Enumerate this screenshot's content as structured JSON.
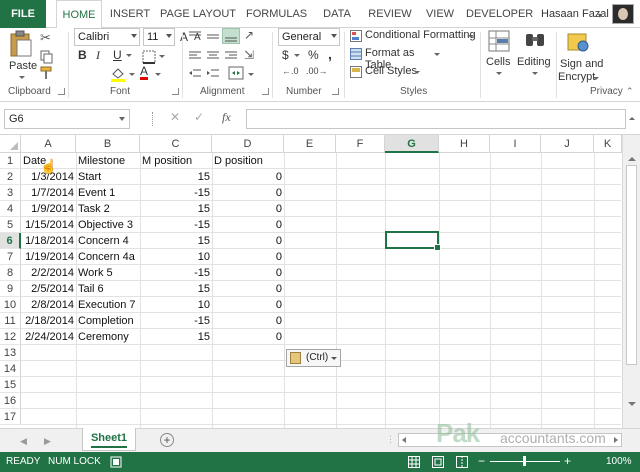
{
  "tabs": {
    "file": "FILE",
    "home": "HOME",
    "insert": "INSERT",
    "page_layout": "PAGE LAYOUT",
    "formulas": "FORMULAS",
    "data": "DATA",
    "review": "REVIEW",
    "view": "VIEW",
    "developer": "DEVELOPER",
    "user": "Hasaan Fazal"
  },
  "ribbon": {
    "clipboard": {
      "label": "Clipboard",
      "paste": "Paste"
    },
    "font": {
      "label": "Font",
      "name": "Calibri",
      "size": "11",
      "bold": "B",
      "italic": "I",
      "underline": "U",
      "grow": "A",
      "shrink": "A",
      "font_color_letter": "A"
    },
    "alignment": {
      "label": "Alignment"
    },
    "number": {
      "label": "Number",
      "format": "General",
      "currency": "$",
      "percent": "%",
      "comma": ","
    },
    "styles": {
      "label": "Styles",
      "conditional": "Conditional Formatting",
      "format_table": "Format as Table",
      "cell_styles": "Cell Styles"
    },
    "cells": {
      "label": "Cells"
    },
    "editing": {
      "label": "Editing"
    },
    "privacy": {
      "label": "Privacy",
      "sign": "Sign and",
      "encrypt": "Encrypt"
    }
  },
  "formula_bar": {
    "name_box": "G6",
    "fx": "fx",
    "cancel": "✕",
    "enter": "✓",
    "value": ""
  },
  "columns": [
    "A",
    "B",
    "C",
    "D",
    "E",
    "F",
    "G",
    "H",
    "I",
    "J",
    "K"
  ],
  "selected_column": "G",
  "rows": [
    "1",
    "2",
    "3",
    "4",
    "5",
    "6",
    "7",
    "8",
    "9",
    "10",
    "11",
    "12",
    "13",
    "14",
    "15",
    "16",
    "17"
  ],
  "selected_row": "6",
  "headers": [
    "Date",
    "Milestone",
    "M position",
    "D position"
  ],
  "table": [
    [
      "1/3/2014",
      "Start",
      "15",
      "0"
    ],
    [
      "1/7/2014",
      "Event 1",
      "-15",
      "0"
    ],
    [
      "1/9/2014",
      "Task 2",
      "15",
      "0"
    ],
    [
      "1/15/2014",
      "Objective 3",
      "-15",
      "0"
    ],
    [
      "1/18/2014",
      "Concern 4",
      "15",
      "0"
    ],
    [
      "1/19/2014",
      "Concern 4a",
      "10",
      "0"
    ],
    [
      "2/2/2014",
      "Work 5",
      "-15",
      "0"
    ],
    [
      "2/5/2014",
      "Tail 6",
      "15",
      "0"
    ],
    [
      "2/8/2014",
      "Execution 7",
      "10",
      "0"
    ],
    [
      "2/18/2014",
      "Completion",
      "-15",
      "0"
    ],
    [
      "2/24/2014",
      "Ceremony",
      "15",
      "0"
    ]
  ],
  "paste_options": "(Ctrl)",
  "sheet_tab": "Sheet1",
  "status": {
    "ready": "READY",
    "num_lock": "NUM LOCK",
    "zoom": "100%",
    "minus": "−",
    "plus": "+"
  },
  "watermark": {
    "brand": "Pak",
    "site": "accountants.com"
  },
  "colors": {
    "excel_green": "#217346"
  }
}
